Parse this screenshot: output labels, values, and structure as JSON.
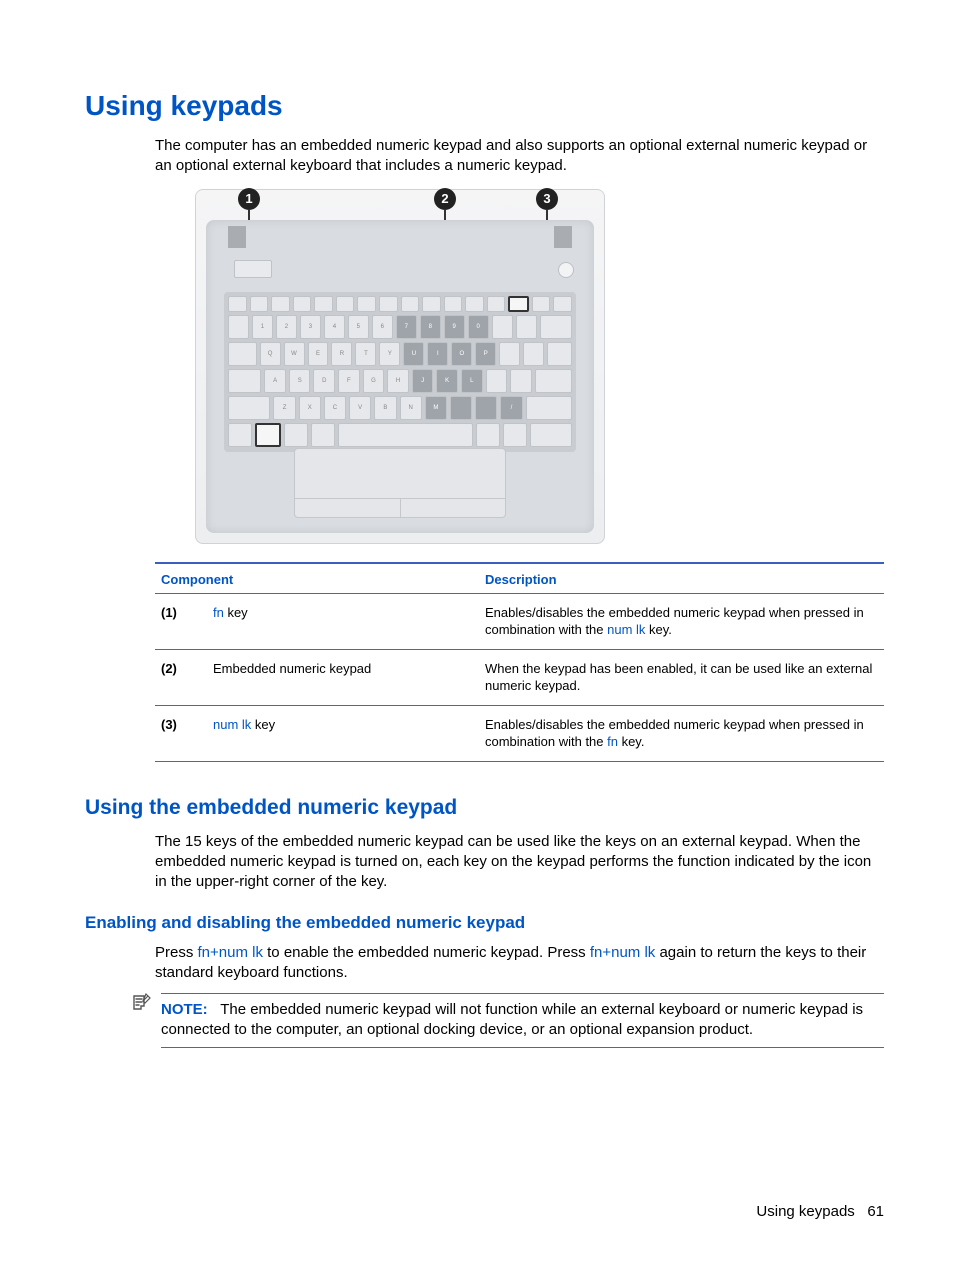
{
  "title": "Using keypads",
  "intro": "The computer has an embedded numeric keypad and also supports an optional external numeric keypad or an optional external keyboard that includes a numeric keypad.",
  "diagram": {
    "callouts": [
      "1",
      "2",
      "3"
    ]
  },
  "table": {
    "headers": {
      "component": "Component",
      "description": "Description"
    },
    "rows": [
      {
        "idx": "(1)",
        "name_pre_link": "",
        "name_link": "fn",
        "name_post_link": " key",
        "desc_pre": "Enables/disables the embedded numeric keypad when pressed in combination with the ",
        "desc_link": "num lk",
        "desc_post": " key."
      },
      {
        "idx": "(2)",
        "name_pre_link": "Embedded numeric keypad",
        "name_link": "",
        "name_post_link": "",
        "desc_pre": "When the keypad has been enabled, it can be used like an external numeric keypad.",
        "desc_link": "",
        "desc_post": ""
      },
      {
        "idx": "(3)",
        "name_pre_link": "",
        "name_link": "num lk",
        "name_post_link": " key",
        "desc_pre": "Enables/disables the embedded numeric keypad when pressed in combination with the ",
        "desc_link": "fn",
        "desc_post": " key."
      }
    ]
  },
  "section2": {
    "heading": "Using the embedded numeric keypad",
    "para": "The 15 keys of the embedded numeric keypad can be used like the keys on an external keypad. When the embedded numeric keypad is turned on, each key on the keypad performs the function indicated by the icon in the upper-right corner of the key."
  },
  "section3": {
    "heading": "Enabling and disabling the embedded numeric keypad",
    "para_pre": "Press ",
    "para_link1": "fn+num lk",
    "para_mid": " to enable the embedded numeric keypad. Press ",
    "para_link2": "fn+num lk",
    "para_post": " again to return the keys to their standard keyboard functions."
  },
  "note": {
    "label": "NOTE:",
    "text": "The embedded numeric keypad will not function while an external keyboard or numeric keypad is connected to the computer, an optional docking device, or an optional expansion product."
  },
  "footer": {
    "text": "Using keypads",
    "page": "61"
  }
}
